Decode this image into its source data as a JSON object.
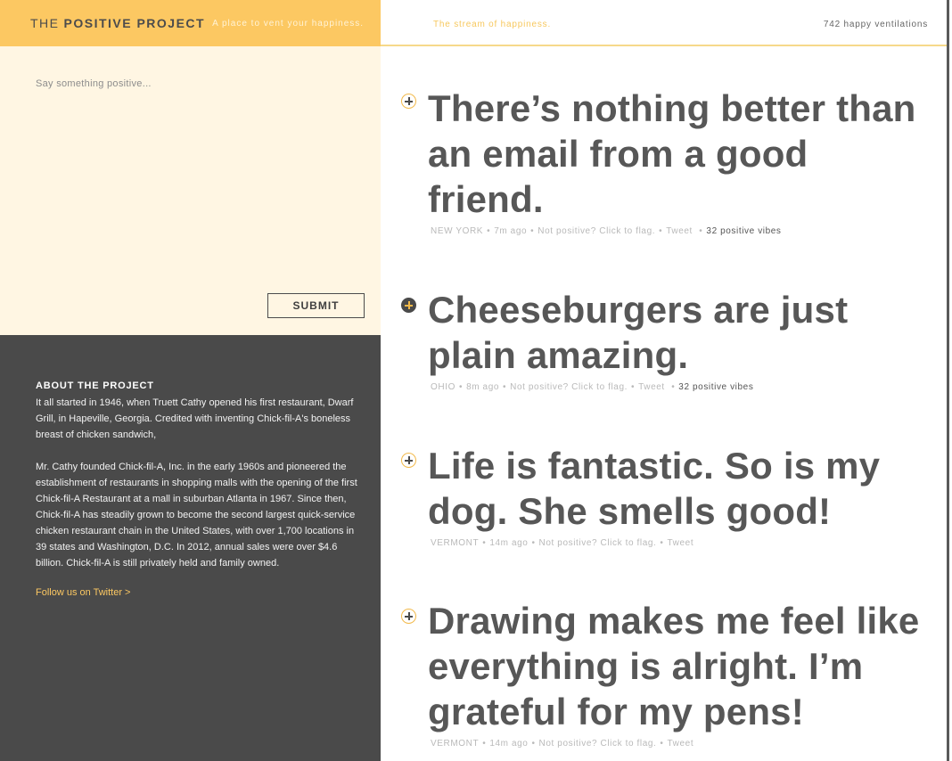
{
  "brand": {
    "prefix": "THE",
    "name": "POSITIVE PROJECT",
    "tagline": "A place to vent your happiness."
  },
  "compose": {
    "placeholder": "Say something positive...",
    "submit_label": "SUBMIT"
  },
  "about": {
    "heading": "ABOUT THE PROJECT",
    "paragraph1": "It all started in 1946, when Truett Cathy opened his first restaurant, Dwarf Grill, in Hapeville, Georgia. Credited with inventing Chick-fil-A's boneless breast of chicken sandwich,",
    "paragraph2": "Mr. Cathy founded Chick-fil-A, Inc. in the early 1960s and pioneered the establishment of restaurants in shopping malls with the opening of the first Chick-fil-A Restaurant at a mall in suburban Atlanta in 1967. Since then, Chick-fil-A has steadily grown to become the second largest quick-service chicken restaurant chain in the United States, with over 1,700 locations in 39 states and Washington, D.C. In 2012, annual sales were over $4.6 billion. Chick-fil-A is still privately held and family owned.",
    "follow_link": "Follow us on Twitter >"
  },
  "stream": {
    "label": "The stream of happiness.",
    "count_text": "742 happy ventilations"
  },
  "posts": [
    {
      "text": "There’s nothing better than an email from a good friend.",
      "location": "NEW YORK",
      "time": "7m ago",
      "flag_text": "Not positive? Click to flag.",
      "tweet_text": "Tweet",
      "vibes": "32 positive vibes",
      "voted": false
    },
    {
      "text": "Cheeseburgers are just plain amazing.",
      "location": "OHIO",
      "time": "8m ago",
      "flag_text": "Not positive? Click to flag.",
      "tweet_text": "Tweet",
      "vibes": "32 positive vibes",
      "voted": true
    },
    {
      "text": "Life is fantastic. So is my dog. She smells good!",
      "location": "VERMONT",
      "time": "14m ago",
      "flag_text": "Not positive? Click to flag.",
      "tweet_text": "Tweet",
      "vibes": "",
      "voted": false
    },
    {
      "text": "Drawing makes me feel like everything is alright. I’m grateful for my pens!",
      "location": "VERMONT",
      "time": "14m ago",
      "flag_text": "Not positive? Click to flag.",
      "tweet_text": "Tweet",
      "vibes": "",
      "voted": false
    }
  ],
  "colors": {
    "brand_yellow": "#fcc862",
    "cream": "#fff6e3",
    "charcoal": "#4a4a4a",
    "text_gray": "#575757"
  },
  "icons": {
    "vote": "plus-circle-icon"
  }
}
